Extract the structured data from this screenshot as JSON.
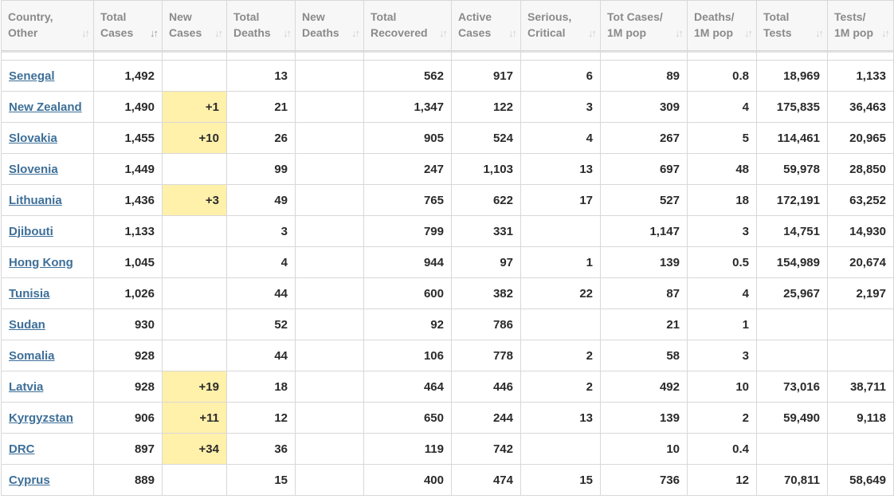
{
  "columns": [
    {
      "label": "Country, Other",
      "sort_icon": "↓↑",
      "sorted": false
    },
    {
      "label": "Total Cases",
      "sort_icon": "↓↑",
      "sorted": true
    },
    {
      "label": "New Cases",
      "sort_icon": "↓↑",
      "sorted": false
    },
    {
      "label": "Total Deaths",
      "sort_icon": "↓↑",
      "sorted": false
    },
    {
      "label": "New Deaths",
      "sort_icon": "↓↑",
      "sorted": false
    },
    {
      "label": "Total Recovered",
      "sort_icon": "↓↑",
      "sorted": false
    },
    {
      "label": "Active Cases",
      "sort_icon": "↓↑",
      "sorted": false
    },
    {
      "label": "Serious, Critical",
      "sort_icon": "↓↑",
      "sorted": false
    },
    {
      "label": "Tot Cases/ 1M pop",
      "sort_icon": "↓↑",
      "sorted": false
    },
    {
      "label": "Deaths/ 1M pop",
      "sort_icon": "↓↑",
      "sorted": false
    },
    {
      "label": "Total Tests",
      "sort_icon": "↓↑",
      "sorted": false
    },
    {
      "label": "Tests/ 1M pop",
      "sort_icon": "↓↑",
      "sorted": false
    }
  ],
  "partial_row": [
    "",
    "",
    "",
    "",
    "",
    "",
    "",
    "",
    "",
    "",
    "",
    ""
  ],
  "rows": [
    [
      "Senegal",
      "1,492",
      "",
      "13",
      "",
      "562",
      "917",
      "6",
      "89",
      "0.8",
      "18,969",
      "1,133"
    ],
    [
      "New Zealand",
      "1,490",
      "+1",
      "21",
      "",
      "1,347",
      "122",
      "3",
      "309",
      "4",
      "175,835",
      "36,463"
    ],
    [
      "Slovakia",
      "1,455",
      "+10",
      "26",
      "",
      "905",
      "524",
      "4",
      "267",
      "5",
      "114,461",
      "20,965"
    ],
    [
      "Slovenia",
      "1,449",
      "",
      "99",
      "",
      "247",
      "1,103",
      "13",
      "697",
      "48",
      "59,978",
      "28,850"
    ],
    [
      "Lithuania",
      "1,436",
      "+3",
      "49",
      "",
      "765",
      "622",
      "17",
      "527",
      "18",
      "172,191",
      "63,252"
    ],
    [
      "Djibouti",
      "1,133",
      "",
      "3",
      "",
      "799",
      "331",
      "",
      "1,147",
      "3",
      "14,751",
      "14,930"
    ],
    [
      "Hong Kong",
      "1,045",
      "",
      "4",
      "",
      "944",
      "97",
      "1",
      "139",
      "0.5",
      "154,989",
      "20,674"
    ],
    [
      "Tunisia",
      "1,026",
      "",
      "44",
      "",
      "600",
      "382",
      "22",
      "87",
      "4",
      "25,967",
      "2,197"
    ],
    [
      "Sudan",
      "930",
      "",
      "52",
      "",
      "92",
      "786",
      "",
      "21",
      "1",
      "",
      ""
    ],
    [
      "Somalia",
      "928",
      "",
      "44",
      "",
      "106",
      "778",
      "2",
      "58",
      "3",
      "",
      ""
    ],
    [
      "Latvia",
      "928",
      "+19",
      "18",
      "",
      "464",
      "446",
      "2",
      "492",
      "10",
      "73,016",
      "38,711"
    ],
    [
      "Kyrgyzstan",
      "906",
      "+11",
      "12",
      "",
      "650",
      "244",
      "13",
      "139",
      "2",
      "59,490",
      "9,118"
    ],
    [
      "DRC",
      "897",
      "+34",
      "36",
      "",
      "119",
      "742",
      "",
      "10",
      "0.4",
      "",
      ""
    ],
    [
      "Cyprus",
      "889",
      "",
      "15",
      "",
      "400",
      "474",
      "15",
      "736",
      "12",
      "70,811",
      "58,649"
    ]
  ],
  "colors": {
    "new_cases_highlight": "#fff0aa",
    "link": "#3d6f98",
    "header_text": "#8a8a8a"
  }
}
